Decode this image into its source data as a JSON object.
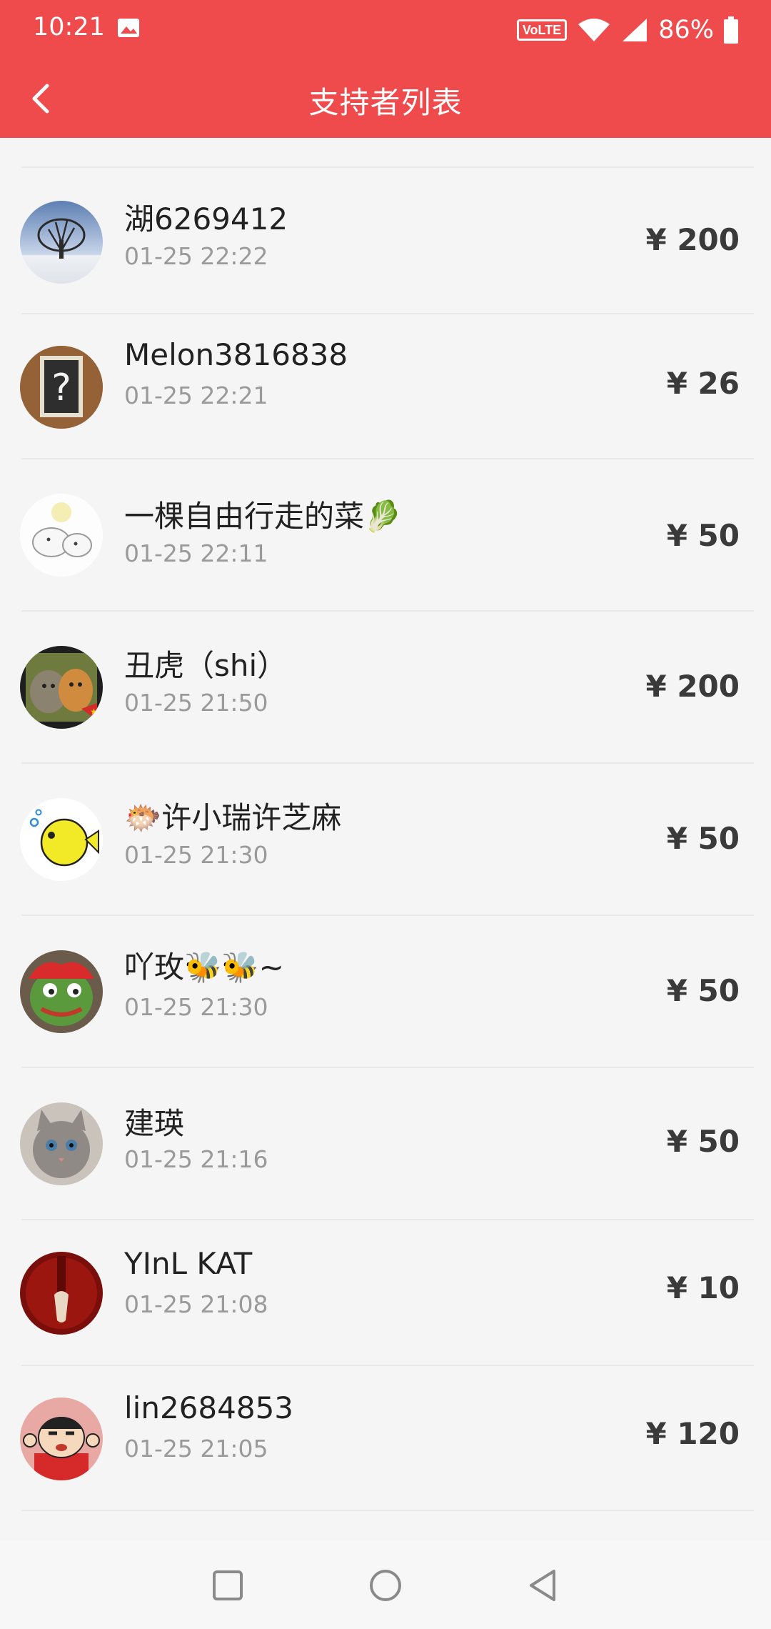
{
  "status_bar": {
    "time": "10:21",
    "network_badge": "VoLTE",
    "battery": "86%",
    "icons": [
      "image-icon",
      "volte-icon",
      "wifi-icon",
      "signal-icon",
      "battery-icon"
    ]
  },
  "app_bar": {
    "title": "支持者列表",
    "back_icon": "back-arrow-icon",
    "background_color": "#ef4b4c"
  },
  "supporters": [
    {
      "name": "湖6269412",
      "time": "01-25 22:22",
      "amount": "¥ 200",
      "avatar": "tree-avatar"
    },
    {
      "name": "Melon3816838",
      "time": "01-25 22:21",
      "amount": "¥ 26",
      "avatar": "question-board-avatar"
    },
    {
      "name": "一棵自由行走的菜🥬",
      "time": "01-25 22:11",
      "amount": "¥ 50",
      "avatar": "cartoon-animals-avatar"
    },
    {
      "name": "丑虎（shi）",
      "time": "01-25 21:50",
      "amount": "¥ 200",
      "avatar": "cats-avatar"
    },
    {
      "name": "🐡许小瑞许芝麻",
      "time": "01-25 21:30",
      "amount": "¥ 50",
      "avatar": "pufferfish-avatar"
    },
    {
      "name": "吖玫🐝🐝~",
      "time": "01-25 21:30",
      "amount": "¥ 50",
      "avatar": "frog-avatar"
    },
    {
      "name": "建瑛",
      "time": "01-25 21:16",
      "amount": "¥ 50",
      "avatar": "kitten-avatar"
    },
    {
      "name": "YInL KAT",
      "time": "01-25 21:08",
      "amount": "¥ 10",
      "avatar": "red-ornament-avatar"
    },
    {
      "name": "lin2684853",
      "time": "01-25 21:05",
      "amount": "¥ 120",
      "avatar": "crayon-shin-avatar"
    }
  ],
  "nav_bar": {
    "buttons": [
      "recents-square-icon",
      "home-circle-icon",
      "back-triangle-icon"
    ]
  }
}
